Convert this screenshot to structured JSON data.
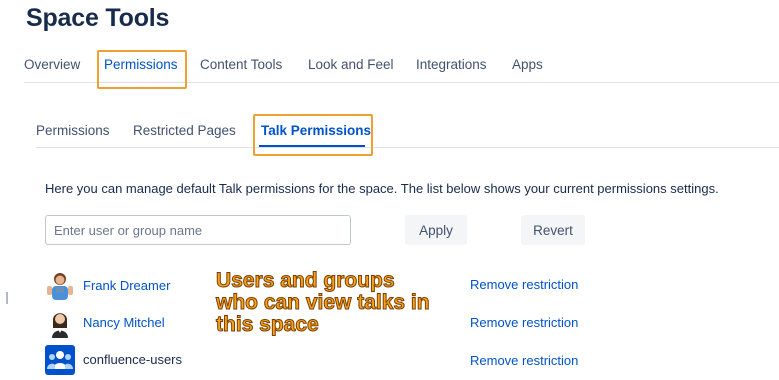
{
  "page": {
    "title": "Space Tools"
  },
  "main_tabs": [
    {
      "label": "Overview"
    },
    {
      "label": "Permissions"
    },
    {
      "label": "Content Tools"
    },
    {
      "label": "Look and Feel"
    },
    {
      "label": "Integrations"
    },
    {
      "label": "Apps"
    }
  ],
  "sub_tabs": [
    {
      "label": "Permissions"
    },
    {
      "label": "Restricted Pages"
    },
    {
      "label": "Talk Permissions"
    }
  ],
  "content": {
    "description": "Here you can manage default Talk permissions for the space. The list below shows your current permissions settings.",
    "search": {
      "placeholder": "Enter user or group name",
      "value": ""
    },
    "apply_label": "Apply",
    "revert_label": "Revert"
  },
  "permissions": [
    {
      "name": "Frank Dreamer",
      "action": "Remove restriction",
      "avatar_icon": "user-avatar-icon"
    },
    {
      "name": "Nancy Mitchel",
      "action": "Remove restriction",
      "avatar_icon": "user-avatar-icon"
    },
    {
      "name": "confluence-users",
      "action": "Remove restriction",
      "avatar_icon": "group-icon"
    }
  ],
  "annotation": {
    "lines": [
      "Users and groups",
      "who can view talks in",
      "this space"
    ]
  },
  "colors": {
    "link": "#0052cc",
    "highlight": "#f0a030",
    "annotation": "#f7a21b"
  }
}
